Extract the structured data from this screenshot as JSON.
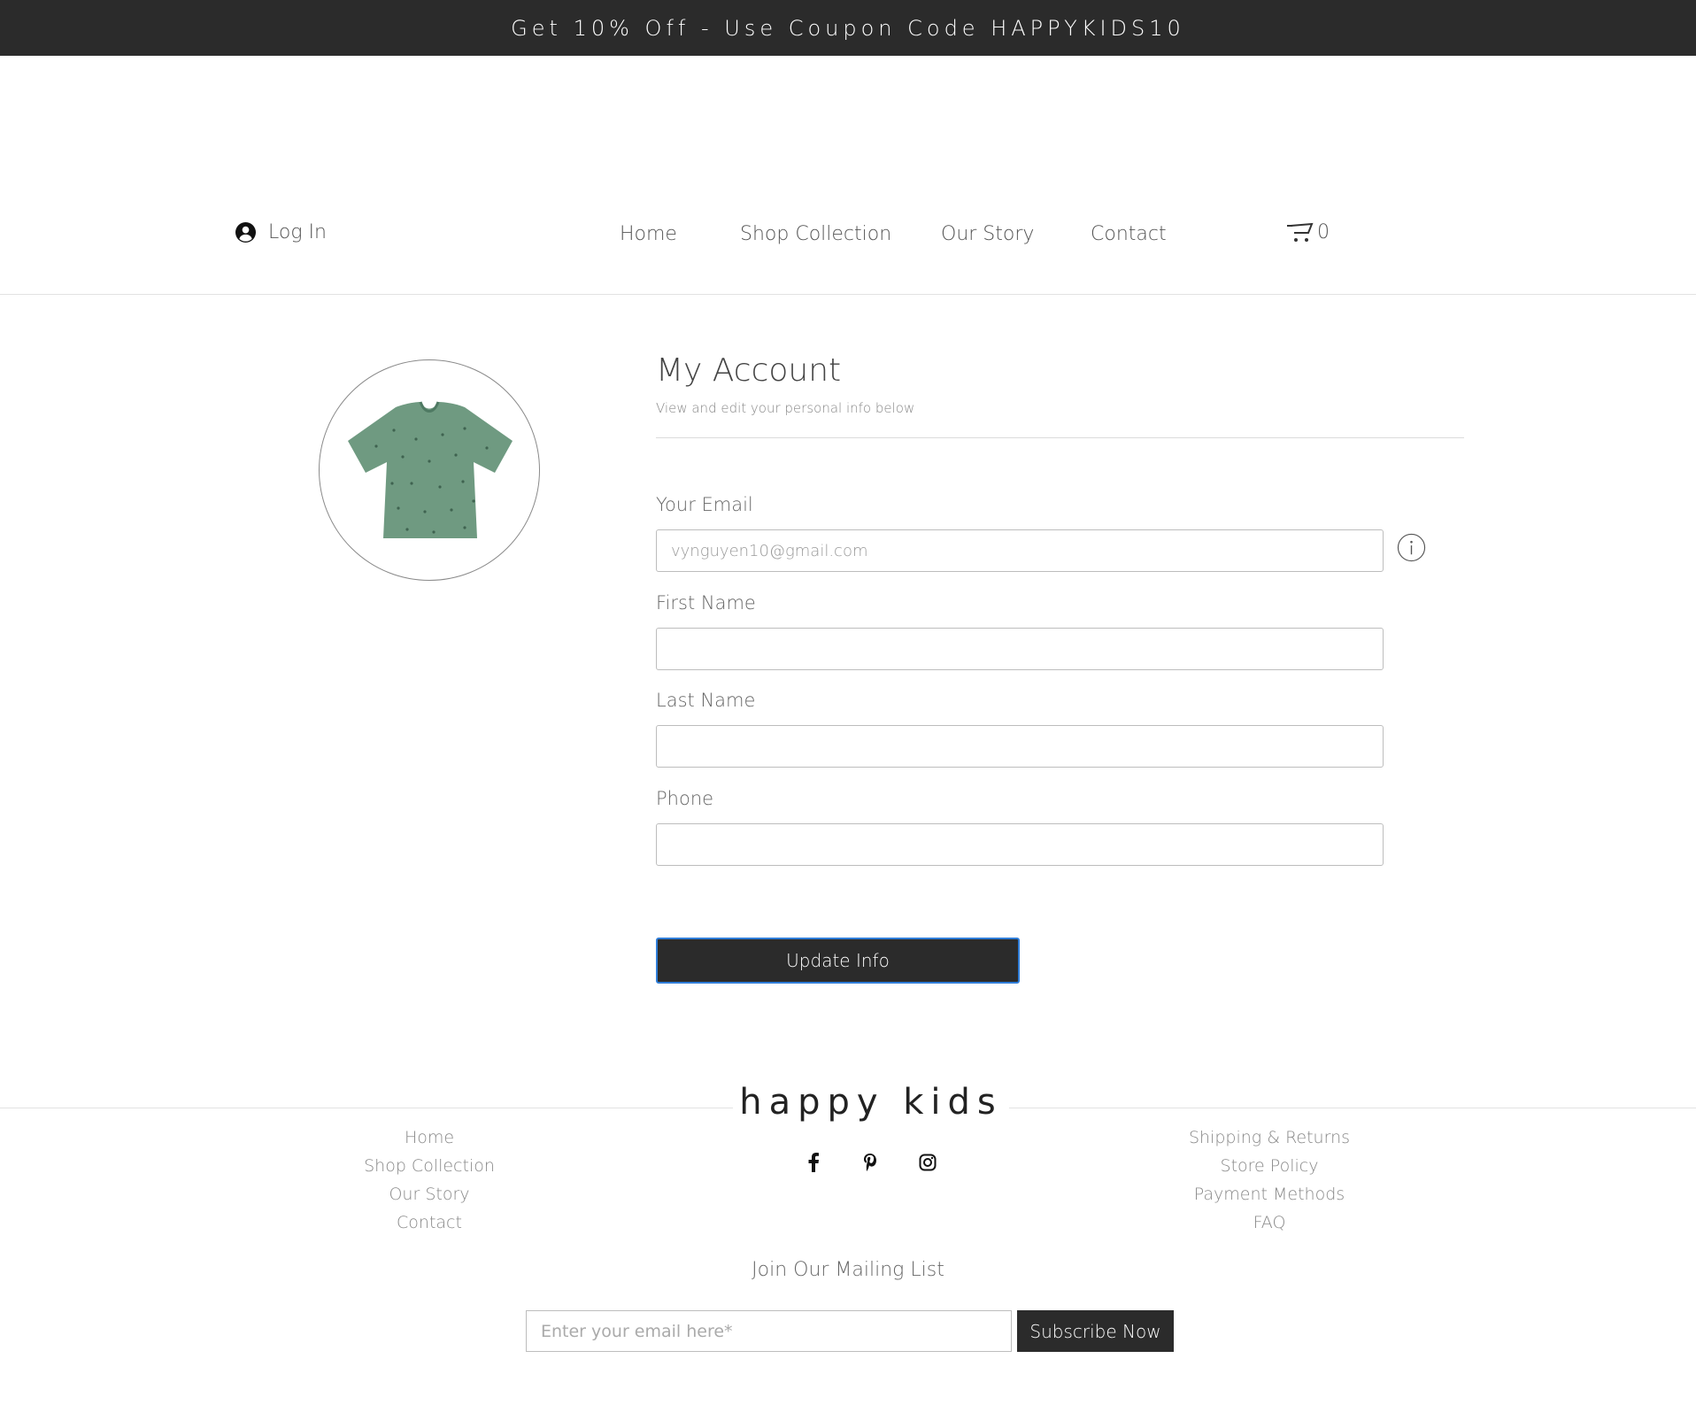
{
  "promo": {
    "text": "Get 10% Off - Use Coupon Code HAPPYKIDS10"
  },
  "header": {
    "login_label": "Log In",
    "nav": [
      {
        "label": "Home"
      },
      {
        "label": "Shop Collection"
      },
      {
        "label": "Our Story"
      },
      {
        "label": "Contact"
      }
    ],
    "cart_count": "0",
    "icons": {
      "login": "user-circle-icon",
      "cart": "cart-icon"
    }
  },
  "profile": {
    "avatar_image": "green-tshirt-image"
  },
  "account": {
    "title": "My Account",
    "subtitle": "View and edit your personal info below",
    "fields": {
      "email": {
        "label": "Your Email",
        "value": "vynguyen10@gmail.com"
      },
      "first_name": {
        "label": "First Name",
        "value": ""
      },
      "last_name": {
        "label": "Last Name",
        "value": ""
      },
      "phone": {
        "label": "Phone",
        "value": ""
      }
    },
    "update_label": "Update Info"
  },
  "footer": {
    "brand": "happy kids",
    "left_links": [
      {
        "label": "Home"
      },
      {
        "label": "Shop Collection"
      },
      {
        "label": "Our Story"
      },
      {
        "label": "Contact"
      }
    ],
    "right_links": [
      {
        "label": "Shipping & Returns"
      },
      {
        "label": "Store Policy"
      },
      {
        "label": "Payment Methods"
      },
      {
        "label": "FAQ"
      }
    ],
    "social": [
      "facebook-icon",
      "pinterest-icon",
      "instagram-icon"
    ],
    "mailing": {
      "title": "Join Our Mailing List",
      "placeholder": "Enter your email here*",
      "button": "Subscribe Now"
    }
  },
  "colors": {
    "dark": "#2b2b2b",
    "text": "#5a5a5a",
    "button_focus_border": "#2f7dd8",
    "tshirt": "#6f9a81"
  }
}
